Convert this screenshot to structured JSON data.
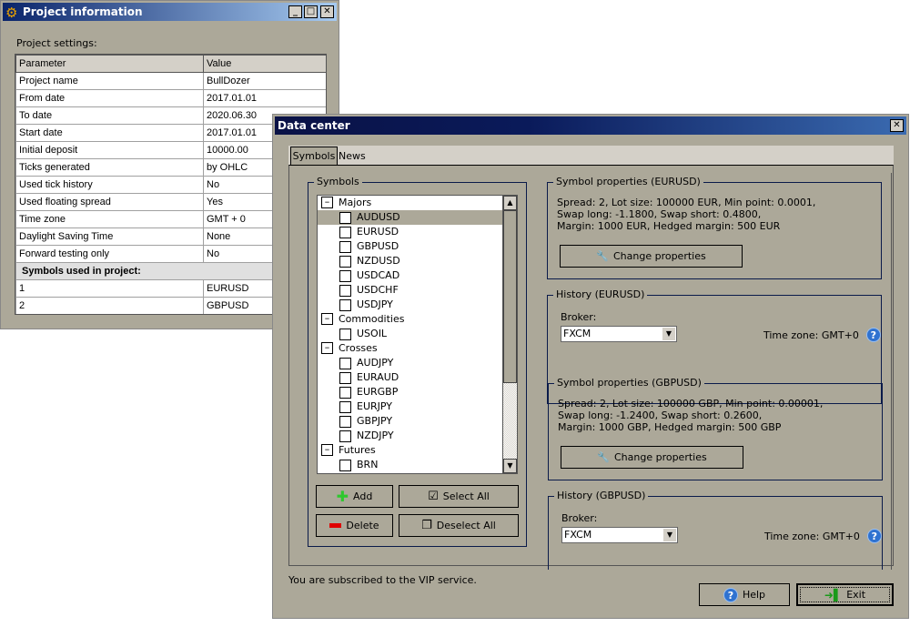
{
  "project_window": {
    "title": "Project information",
    "settings_label": "Project settings:",
    "columns": [
      "Parameter",
      "Value"
    ],
    "rows": [
      [
        "Project name",
        "BullDozer"
      ],
      [
        "From date",
        "2017.01.01"
      ],
      [
        "To date",
        "2020.06.30"
      ],
      [
        "Start date",
        "2017.01.01"
      ],
      [
        "Initial deposit",
        "10000.00"
      ],
      [
        "Ticks generated",
        "by OHLC"
      ],
      [
        "Used tick history",
        "No"
      ],
      [
        "Used floating spread",
        "Yes"
      ],
      [
        "Time zone",
        "GMT + 0"
      ],
      [
        "Daylight Saving Time",
        "None"
      ],
      [
        "Forward testing only",
        "No"
      ]
    ],
    "symbols_header": "Symbols used in project:",
    "symbols": [
      [
        "1",
        "EURUSD"
      ],
      [
        "2",
        "GBPUSD"
      ]
    ]
  },
  "data_center": {
    "title": "Data center",
    "tabs": [
      {
        "label": "Symbols",
        "active": true
      },
      {
        "label": "News",
        "active": false
      }
    ],
    "symbols_group": "Symbols",
    "tree": [
      {
        "group": "Majors",
        "items": [
          "AUDUSD",
          "EURUSD",
          "GBPUSD",
          "NZDUSD",
          "USDCAD",
          "USDCHF",
          "USDJPY"
        ]
      },
      {
        "group": "Commodities",
        "items": [
          "USOIL"
        ]
      },
      {
        "group": "Crosses",
        "items": [
          "AUDJPY",
          "EURAUD",
          "EURGBP",
          "EURJPY",
          "GBPJPY",
          "NZDJPY"
        ]
      },
      {
        "group": "Futures",
        "items": [
          "BRN"
        ]
      }
    ],
    "selected_item": "AUDUSD",
    "buttons": {
      "add": "Add",
      "select_all": "Select All",
      "delete": "Delete",
      "deselect_all": "Deselect All",
      "help": "Help",
      "exit": "Exit"
    },
    "panels": [
      {
        "props_title": "Symbol properties (EURUSD)",
        "lines": [
          "Spread: 2, Lot size: 100000 EUR, Min point: 0.0001,",
          "Swap long: -1.1800, Swap short: 0.4800,",
          "Margin: 1000 EUR, Hedged margin: 500 EUR"
        ],
        "change_label": "Change properties",
        "history_title": "History (EURUSD)",
        "broker_label": "Broker:",
        "broker": "FXCM",
        "timezone": "Time zone: GMT+0"
      },
      {
        "props_title": "Symbol properties (GBPUSD)",
        "lines": [
          "Spread: 2, Lot size: 100000 GBP, Min point: 0.00001,",
          "Swap long: -1.2400, Swap short: 0.2600,",
          "Margin: 1000 GBP, Hedged margin: 500 GBP"
        ],
        "change_label": "Change properties",
        "history_title": "History (GBPUSD)",
        "broker_label": "Broker:",
        "broker": "FXCM",
        "timezone": "Time zone: GMT+0"
      }
    ],
    "status": "You are subscribed to the VIP service.",
    "colors": {
      "face": "#aca899",
      "title_dark": "#0a1246",
      "title_light": "#a6caf0"
    }
  }
}
